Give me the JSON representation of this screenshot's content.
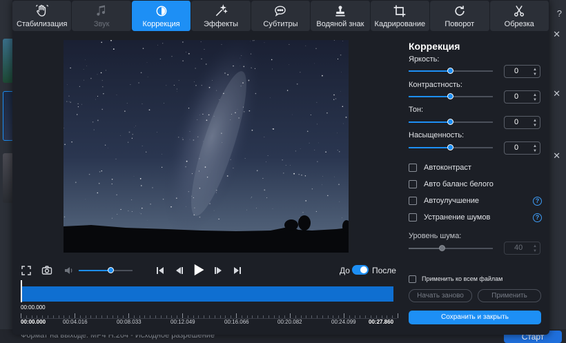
{
  "tabs": [
    {
      "label": "Стабилизация",
      "icon": "hand-icon"
    },
    {
      "label": "Звук",
      "icon": "music-note-icon"
    },
    {
      "label": "Коррекция",
      "icon": "contrast-icon"
    },
    {
      "label": "Эффекты",
      "icon": "magic-wand-icon"
    },
    {
      "label": "Субтитры",
      "icon": "speech-bubble-icon"
    },
    {
      "label": "Водяной знак",
      "icon": "stamp-icon"
    },
    {
      "label": "Кадрирование",
      "icon": "crop-icon"
    },
    {
      "label": "Поворот",
      "icon": "rotate-icon"
    },
    {
      "label": "Обрезка",
      "icon": "scissors-icon"
    }
  ],
  "active_tab": "Коррекция",
  "disabled_tab": "Звук",
  "player": {
    "before_label": "До",
    "after_label": "После",
    "volume_level": 0.6,
    "compare_toggle_on": true
  },
  "timeline": {
    "current_time": "00:00.000",
    "ticks": [
      "00:00.000",
      "00:04.016",
      "00:08.033",
      "00:12.049",
      "00:16.066",
      "00:20.082",
      "00:24.099",
      "00:27.860"
    ]
  },
  "panel": {
    "title": "Коррекция",
    "sliders": [
      {
        "label": "Яркость:",
        "value": "0",
        "level": 0.5
      },
      {
        "label": "Контрастность:",
        "value": "0",
        "level": 0.5
      },
      {
        "label": "Тон:",
        "value": "0",
        "level": 0.5
      },
      {
        "label": "Насыщенность:",
        "value": "0",
        "level": 0.5
      }
    ],
    "checkboxes": [
      {
        "label": "Автоконтраст",
        "checked": false,
        "help": false
      },
      {
        "label": "Авто баланс белого",
        "checked": false,
        "help": false
      },
      {
        "label": "Автоулучшение",
        "checked": false,
        "help": true
      },
      {
        "label": "Устранение шумов",
        "checked": false,
        "help": true
      }
    ],
    "noise": {
      "label": "Уровень шума:",
      "value": "40",
      "level": 0.4,
      "disabled": true
    },
    "apply_all_label": "Применить ко всем файлам",
    "reset_label": "Начать заново",
    "apply_label": "Применить",
    "save_label": "Сохранить и закрыть",
    "help_glyph": "?"
  },
  "background": {
    "status_text": "Формат на выходе: MP4 H.264 - Исходное разрешение",
    "start_label": "Старт"
  },
  "colors": {
    "accent": "#1d8ff5",
    "dialog_bg": "#1c1f26",
    "tab_bg": "#2b2f37"
  }
}
